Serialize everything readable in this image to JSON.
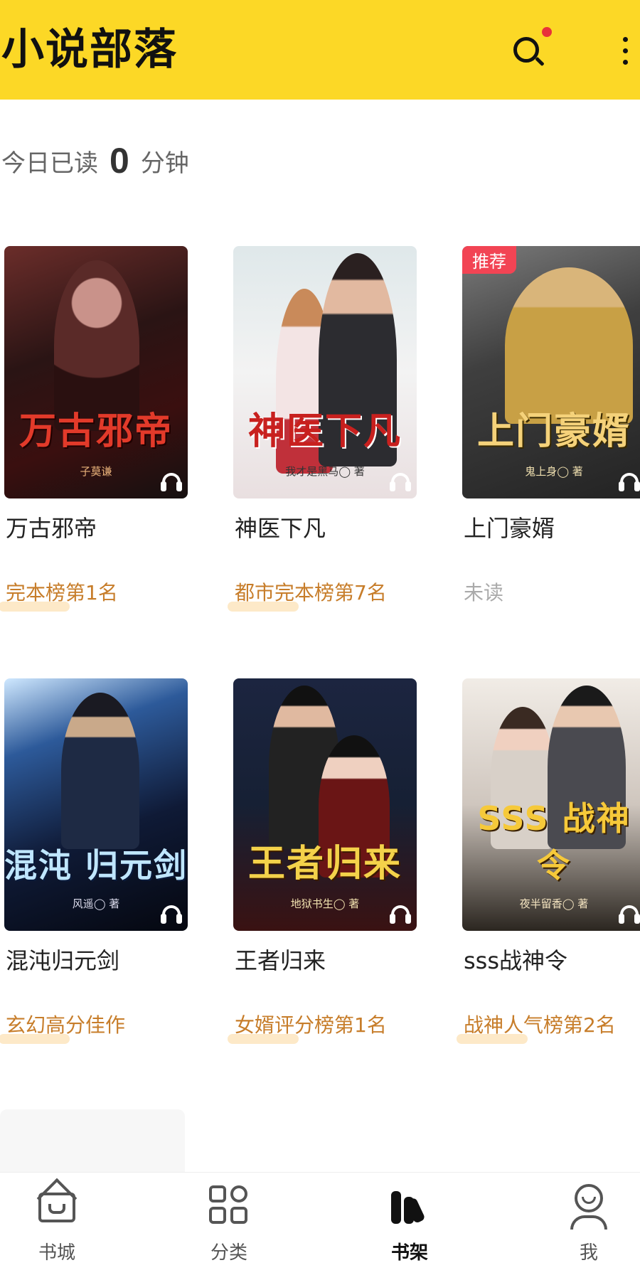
{
  "header": {
    "title": "小说部落",
    "search_icon": "search-icon",
    "more_icon": "more-vertical-icon",
    "background": "#fcd826",
    "notification_dot": "#e8323a"
  },
  "reading": {
    "prefix": "今日已读",
    "minutes": "0",
    "suffix": "分钟"
  },
  "books": [
    {
      "title": "万古邪帝",
      "cover_title": "万古邪帝",
      "cover_author": "子莫谦",
      "tag": "完本榜第1名",
      "audio": true
    },
    {
      "title": "神医下凡",
      "cover_title": "神医下凡",
      "cover_author": "我才是黑马◯ 著",
      "tag": "都市完本榜第7名",
      "audio": true
    },
    {
      "title": "上门豪婿",
      "cover_title": "上门豪婿",
      "cover_author": "鬼上身◯ 著",
      "tag": "未读",
      "badge": "推荐",
      "audio": true
    },
    {
      "title": "混沌归元剑",
      "cover_title": "混沌 归元剑",
      "cover_author": "风遥◯ 著",
      "tag": "玄幻高分佳作",
      "audio": true
    },
    {
      "title": "王者归来",
      "cover_title": "王者归来",
      "cover_author": "地狱书生◯ 著",
      "tag": "女婿评分榜第1名",
      "audio": true
    },
    {
      "title": "sss战神令",
      "cover_title": "SSS 战神令",
      "cover_author": "夜半留香◯ 著",
      "tag": "战神人气榜第2名",
      "audio": true
    }
  ],
  "tag_color": "#c77d2a",
  "unread_color": "#aaaaaa",
  "badge_color": "#f24454",
  "nav": {
    "items": [
      {
        "label": "书城",
        "icon": "bookstore-icon"
      },
      {
        "label": "分类",
        "icon": "category-icon"
      },
      {
        "label": "书架",
        "icon": "bookshelf-icon",
        "active": true
      },
      {
        "label": "我",
        "icon": "profile-icon"
      }
    ]
  }
}
